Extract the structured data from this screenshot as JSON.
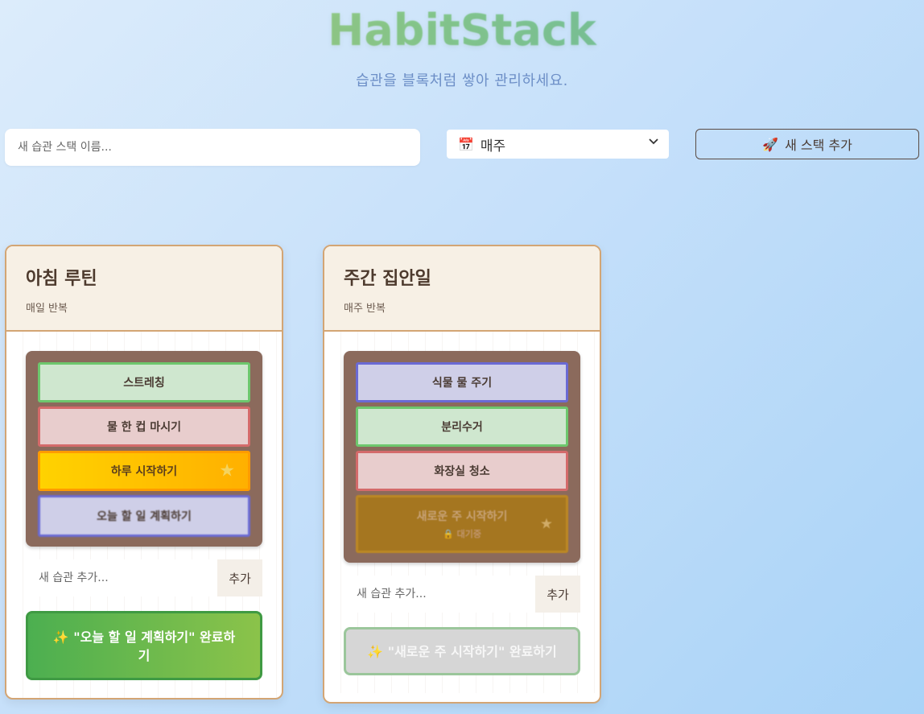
{
  "app": {
    "title": "HabitStack",
    "subtitle": "습관을 블록처럼 쌓아 관리하세요."
  },
  "toolbar": {
    "stack_name_placeholder": "새 습관 스택 이름...",
    "frequency_icon": "calendar-icon",
    "frequency_selected": "매주",
    "add_stack_icon": "rocket-icon",
    "add_stack_label": "새 스택 추가"
  },
  "stacks": [
    {
      "name": "아침 루틴",
      "frequency": "매일 반복",
      "habits": [
        {
          "label": "스트레칭",
          "color": "green"
        },
        {
          "label": "물 한 컵 마시기",
          "color": "red"
        },
        {
          "label": "하루 시작하기",
          "color": "gold",
          "star": "★"
        },
        {
          "label": "오늘 할 일 계획하기",
          "color": "blue"
        }
      ],
      "add_placeholder": "새 습관 추가...",
      "add_label": "추가",
      "complete_label": "✨ \"오늘 할 일 계획하기\" 완료하기"
    },
    {
      "name": "주간 집안일",
      "frequency": "매주 반복",
      "habits": [
        {
          "label": "식물 물 주기",
          "color": "blue"
        },
        {
          "label": "분리수거",
          "color": "green"
        },
        {
          "label": "화장실 청소",
          "color": "red"
        },
        {
          "label": "새로운 주 시작하기",
          "color": "pending",
          "status": "🔒 대기중",
          "star": "★"
        }
      ],
      "add_placeholder": "새 습관 추가...",
      "add_label": "추가",
      "complete_label": "✨ \"새로운 주 시작하기\" 완료하기"
    }
  ],
  "colors": {
    "card_border": "#d3a574",
    "stack_bg": "#8b6a5c",
    "complete_green": "#4caf50"
  }
}
